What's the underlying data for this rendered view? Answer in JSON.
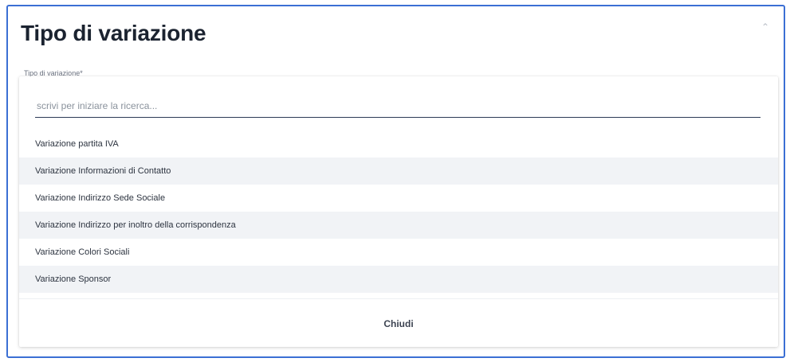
{
  "title": "Tipo di variazione",
  "field_label": "Tipo di variazione*",
  "search": {
    "placeholder": "scrivi per iniziare la ricerca..."
  },
  "options": [
    "Variazione partita IVA",
    "Variazione Informazioni di Contatto",
    "Variazione Indirizzo Sede Sociale",
    "Variazione Indirizzo per inoltro della corrispondenza",
    "Variazione Colori Sociali",
    "Variazione Sponsor"
  ],
  "close_label": "Chiudi",
  "icons": {
    "collapse": "chevron-up-icon"
  }
}
